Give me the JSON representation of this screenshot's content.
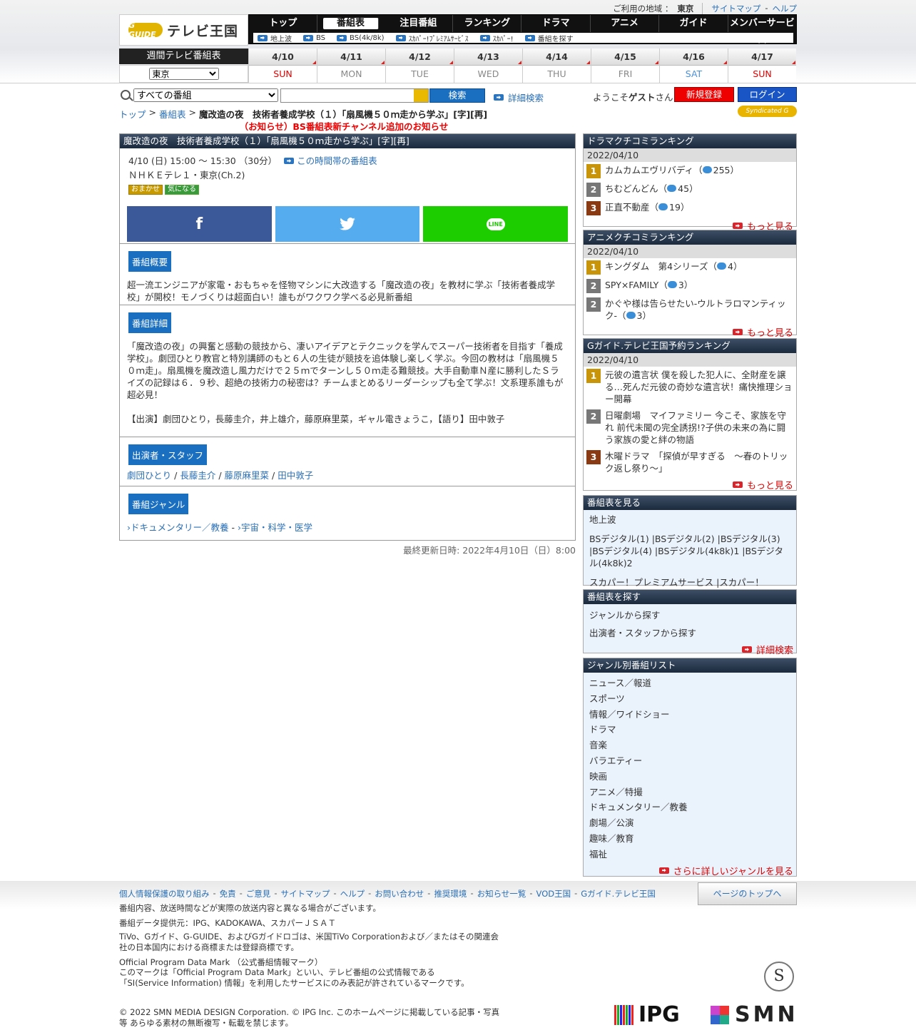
{
  "util": {
    "region_label": "ご利用の地域 ：",
    "region": "東京",
    "sitemap": "サイトマップ",
    "dash": "-",
    "help": "ヘルプ"
  },
  "logo": {
    "mark": "G GUIDE",
    "text": "テレビ王国"
  },
  "nav": {
    "items": [
      "トップ",
      "番組表",
      "注目番組",
      "ランキング",
      "ドラマ",
      "アニメ",
      "ガイド",
      "メンバーサービス"
    ],
    "sub": [
      "地上波",
      "BS",
      "BS(4k/8k)",
      "ｽｶﾊﾟｰ!ﾌﾟﾚﾐｱﾑｻｰﾋﾞｽ",
      "ｽｶﾊﾟｰ!",
      "番組を探す"
    ]
  },
  "week": {
    "label": "週間テレビ番組表",
    "area": "東京",
    "days": [
      {
        "d": "4/10",
        "w": "SUN",
        "c": "#e00000"
      },
      {
        "d": "4/11",
        "w": "MON",
        "c": "#888888"
      },
      {
        "d": "4/12",
        "w": "TUE",
        "c": "#888888"
      },
      {
        "d": "4/13",
        "w": "WED",
        "c": "#888888"
      },
      {
        "d": "4/14",
        "w": "THU",
        "c": "#888888"
      },
      {
        "d": "4/15",
        "w": "FRI",
        "c": "#888888"
      },
      {
        "d": "4/16",
        "w": "SAT",
        "c": "#4a90d9"
      },
      {
        "d": "4/17",
        "w": "SUN",
        "c": "#e00000"
      }
    ]
  },
  "search": {
    "scope": "すべての番組",
    "button": "検索",
    "advanced": "詳細検索",
    "welcome_pre": "ようこそ",
    "guest": "ゲスト",
    "welcome_post": "さん",
    "register": "新規登録",
    "login": "ログイン"
  },
  "crumb": {
    "top": "トップ",
    "sep": ">",
    "listing": "番組表",
    "current": "魔改造の夜　技術者養成学校（１）「扇風機５０ｍ走から学ぶ」[字][再]"
  },
  "syndicated": "Syndicated G GUIDE",
  "notice": "（お知らせ）BS番組表新チャンネル追加のお知らせ",
  "program": {
    "title": "魔改造の夜　技術者養成学校（１）「扇風機５０ｍ走から学ぶ」[字][再]",
    "time": "4/10 (日) 15:00 ～ 15:30 （30分）",
    "timeslot_link": "この時間帯の番組表",
    "channel": "ＮＨＫＥテレ１・東京(Ch.2)",
    "tags": [
      "おまかせ",
      "気になる"
    ],
    "share": [
      "f",
      "twitter",
      "LINE"
    ],
    "summary_h": "番組概要",
    "summary": "超一流エンジニアが家電・おもちゃを怪物マシンに大改造する「魔改造の夜」を教材に学ぶ「技術者養成学校」が開校！モノづくりは超面白い！誰もがワクワク学べる必見新番組",
    "detail_h": "番組詳細",
    "detail": "「魔改造の夜」の興奮と感動の競技から、凄いアイデアとテクニックを学んでスーパー技術者を目指す「養成学校」。劇団ひとり教官と特別講師のもと６人の生徒が競技を追体験し楽しく学ぶ。今回の教材は「扇風機５０ｍ走」。扇風機を魔改造し風力だけで２５ｍでターンし５０ｍ走る難競技。大手自動車Ｎ産に勝利したＳライズの記録は６．９秒、超絶の技術力の秘密は？チームまとめるリーダーシップも全て学ぶ！文系理系誰もが超必見！",
    "cast_line": "【出演】劇団ひとり，長藤圭介，井上雄介，藤原麻里菜，ギャル電きょうこ，【語り】田中敦子",
    "staff_h": "出演者・スタッフ",
    "staff": [
      "劇団ひとり",
      "長藤圭介",
      "藤原麻里菜",
      "田中敦子"
    ],
    "staff_sep": "/",
    "genre_h": "番組ジャンル",
    "genres": [
      "ドキュメンタリー／教養",
      "宇宙・科学・医学"
    ],
    "genre_sep": "-"
  },
  "updated": "最終更新日時: 2022年4月10日（日）8:00",
  "side": {
    "drama": {
      "title": "ドラマクチコミランキング",
      "date": "2022/04/10",
      "items": [
        {
          "n": "1",
          "t": "カムカムエヴリバディ",
          "c": "255"
        },
        {
          "n": "2",
          "t": "ちむどんどん",
          "c": "45"
        },
        {
          "n": "3",
          "t": "正直不動産",
          "c": "19"
        }
      ],
      "more": "もっと見る"
    },
    "anime": {
      "title": "アニメクチコミランキング",
      "date": "2022/04/10",
      "items": [
        {
          "n": "1",
          "t": "キングダム　第4シリーズ",
          "c": "4"
        },
        {
          "n": "2",
          "t": "SPY×FAMILY",
          "c": "3"
        },
        {
          "n": "2",
          "t": "かぐや様は告らせたい-ウルトラロマンティック-",
          "c": "3"
        }
      ],
      "more": "もっと見る"
    },
    "reserve": {
      "title": "Gガイド.テレビ王国予約ランキング",
      "date": "2022/04/10",
      "items": [
        {
          "n": "1",
          "t": "元彼の遺言状 僕を殺した犯人に、全財産を譲る…死んだ元彼の奇妙な遺言状！痛快推理ショー開幕"
        },
        {
          "n": "2",
          "t": "日曜劇場　マイファミリー 今こそ、家族を守れ 前代未聞の完全誘拐!?子供の未来の為に闘う家族の愛と絆の物語"
        },
        {
          "n": "3",
          "t": "木曜ドラマ　「探偵が早すぎる　〜春のトリック返し祭り〜」"
        }
      ],
      "more": "もっと見る"
    },
    "listings": {
      "title": "番組表を見る",
      "terrestrial": "地上波",
      "bs": "BSデジタル(1) |BSデジタル(2) |BSデジタル(3) |BSデジタル(4) |BSデジタル(4k8k)1 |BSデジタル(4k8k)2",
      "sky": "スカパー！プレミアムサービス |スカパー！"
    },
    "find": {
      "title": "番組表を探す",
      "items": [
        "ジャンルから探す",
        "出演者・スタッフから探す"
      ],
      "more": "詳細検索"
    },
    "genre": {
      "title": "ジャンル別番組リスト",
      "items": [
        "ニュース／報道",
        "スポーツ",
        "情報／ワイドショー",
        "ドラマ",
        "音楽",
        "バラエティー",
        "映画",
        "アニメ／特撮",
        "ドキュメンタリー／教養",
        "劇場／公演",
        "趣味／教育",
        "福祉"
      ],
      "more": "さらに詳しいジャンルを見る"
    }
  },
  "footer": {
    "links": [
      "個人情報保護の取り組み",
      "免責",
      "ご意見",
      "サイトマップ",
      "ヘルプ",
      "お問い合わせ",
      "推奨環境",
      "お知らせ一覧",
      "VOD王国",
      "Gガイド.テレビ王国"
    ],
    "link_sep": "-",
    "pagetop": "ページのトップへ",
    "note1": "番組内容、放送時間などが実際の放送内容と異なる場合がございます。",
    "note2": "番組データ提供元：IPG、KADOKAWA、スカパーＪＳＡＴ",
    "note3": "TiVo、Gガイド、G-GUIDE、およびGガイドロゴは、米国TiVo Corporationおよび／またはその関連会社の日本国内における商標または登録商標です。",
    "note4": "Official Program Data Mark （公式番組情報マーク）",
    "note5": "このマークは「Official Program Data Mark」といい、テレビ番組の公式情報である「SI(Service Information) 情報」を利用したサービスにのみ表記が許されているマークです。",
    "copyright": "© 2022 SMN MEDIA DESIGN Corporation. © IPG Inc. このホームページに掲載している記事・写真等 あらゆる素材の無断複写・転載を禁じます。",
    "odm": "S",
    "ipg": "IPG",
    "smn": "SMN"
  }
}
